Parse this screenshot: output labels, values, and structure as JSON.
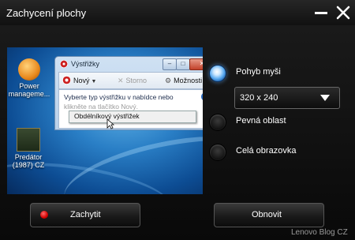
{
  "window": {
    "title": "Zachycení plochy"
  },
  "preview": {
    "desktop_icons": [
      {
        "label_line1": "Power",
        "label_line2": "manageme..."
      },
      {
        "label_line1": "Predátor",
        "label_line2": "(1987) CZ"
      }
    ],
    "snipping_tool": {
      "title": "Výstřižky",
      "toolbar": {
        "new": "Nový",
        "cancel": "Storno",
        "options": "Možnosti"
      },
      "hint": "Vyberte typ výstřižku v nabídce nebo",
      "hint2": "klikněte na tlačítko Nový.",
      "menu_item": "Obdélníkový výstřižek"
    }
  },
  "options": [
    {
      "label": "Pohyb myši",
      "selected": true
    },
    {
      "label": "Pevná oblast",
      "selected": false
    },
    {
      "label": "Celá obrazovka",
      "selected": false
    }
  ],
  "size_select": {
    "value": "320 x 240"
  },
  "buttons": {
    "capture": "Zachytit",
    "refresh": "Obnovit"
  },
  "watermark": "Lenovo Blog CZ",
  "colors": {
    "background": "#0d0d0d",
    "radio_selected": "#5aaaf0",
    "record_dot": "#d10000"
  }
}
